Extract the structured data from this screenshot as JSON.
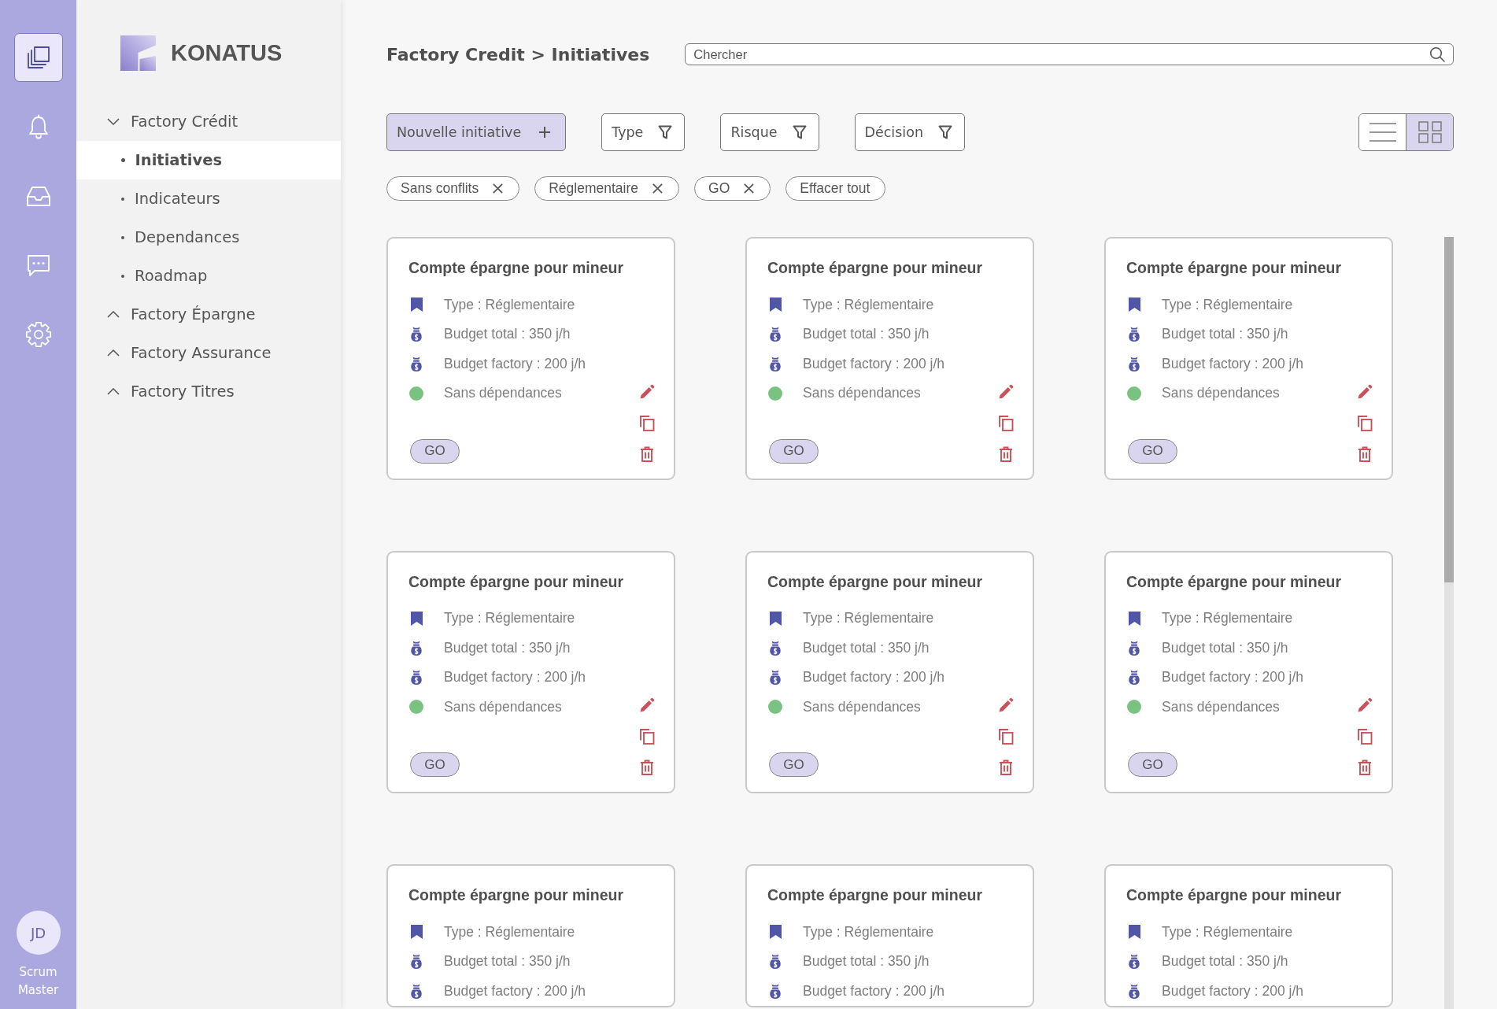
{
  "rail": {
    "items": [
      {
        "kind": "layers",
        "selected": true
      },
      {
        "kind": "bell",
        "selected": false
      },
      {
        "kind": "inbox",
        "selected": false
      },
      {
        "kind": "chat",
        "selected": false
      },
      {
        "kind": "settings",
        "selected": false
      }
    ],
    "user": {
      "initials": "JD",
      "role": "Scrum Master"
    }
  },
  "sidebar": {
    "brand": "KONATUS",
    "tree": [
      {
        "label": "Factory Crédit",
        "expanded": true,
        "children": [
          {
            "label": "Initiatives",
            "selected": true
          },
          {
            "label": "Indicateurs",
            "selected": false
          },
          {
            "label": "Dependances",
            "selected": false
          },
          {
            "label": "Roadmap",
            "selected": false
          }
        ]
      },
      {
        "label": "Factory Épargne",
        "expanded": false
      },
      {
        "label": "Factory Assurance",
        "expanded": false
      },
      {
        "label": "Factory Titres",
        "expanded": false
      }
    ]
  },
  "header": {
    "breadcrumb": "Factory Credit > Initiatives",
    "search": {
      "placeholder": "Chercher"
    }
  },
  "toolbar": {
    "buttons": [
      {
        "label": "Nouvelle initiative",
        "kind": "add"
      },
      {
        "label": "Type",
        "kind": "filter"
      },
      {
        "label": "Risque",
        "kind": "filter"
      },
      {
        "label": "Décision",
        "kind": "filter"
      }
    ],
    "view_toggle": [
      {
        "kind": "list",
        "selected": false
      },
      {
        "kind": "grid",
        "selected": true
      }
    ]
  },
  "active_filters": [
    {
      "label": "Sans conflits",
      "kind": "filter"
    },
    {
      "label": "Réglementaire",
      "kind": "filter"
    },
    {
      "label": "GO",
      "kind": "filter"
    },
    {
      "label": "Effacer tout",
      "kind": "clear"
    }
  ],
  "cards": [
    {
      "title": "Compte épargne pour mineur",
      "rows": [
        {
          "kind": "type",
          "text": "Type : Réglementaire"
        },
        {
          "kind": "budget",
          "text": "Budget total : 350 j/h"
        },
        {
          "kind": "budget",
          "text": "Budget factory : 200 j/h"
        },
        {
          "kind": "status",
          "text": "Sans dépendances",
          "color": "#79c27f"
        }
      ],
      "decision": "GO",
      "actions": [
        {
          "kind": "edit"
        },
        {
          "kind": "copy"
        },
        {
          "kind": "delete"
        }
      ]
    },
    {
      "title": "Compte épargne pour mineur",
      "rows": [
        {
          "kind": "type",
          "text": "Type : Réglementaire"
        },
        {
          "kind": "budget",
          "text": "Budget total : 350 j/h"
        },
        {
          "kind": "budget",
          "text": "Budget factory : 200 j/h"
        },
        {
          "kind": "status",
          "text": "Sans dépendances",
          "color": "#79c27f"
        }
      ],
      "decision": "GO",
      "actions": [
        {
          "kind": "edit"
        },
        {
          "kind": "copy"
        },
        {
          "kind": "delete"
        }
      ]
    },
    {
      "title": "Compte épargne pour mineur",
      "rows": [
        {
          "kind": "type",
          "text": "Type : Réglementaire"
        },
        {
          "kind": "budget",
          "text": "Budget total : 350 j/h"
        },
        {
          "kind": "budget",
          "text": "Budget factory : 200 j/h"
        },
        {
          "kind": "status",
          "text": "Sans dépendances",
          "color": "#79c27f"
        }
      ],
      "decision": "GO",
      "actions": [
        {
          "kind": "edit"
        },
        {
          "kind": "copy"
        },
        {
          "kind": "delete"
        }
      ]
    },
    {
      "title": "Compte épargne pour mineur",
      "rows": [
        {
          "kind": "type",
          "text": "Type : Réglementaire"
        },
        {
          "kind": "budget",
          "text": "Budget total : 350 j/h"
        },
        {
          "kind": "budget",
          "text": "Budget factory : 200 j/h"
        },
        {
          "kind": "status",
          "text": "Sans dépendances",
          "color": "#79c27f"
        }
      ],
      "decision": "GO",
      "actions": [
        {
          "kind": "edit"
        },
        {
          "kind": "copy"
        },
        {
          "kind": "delete"
        }
      ]
    },
    {
      "title": "Compte épargne pour mineur",
      "rows": [
        {
          "kind": "type",
          "text": "Type : Réglementaire"
        },
        {
          "kind": "budget",
          "text": "Budget total : 350 j/h"
        },
        {
          "kind": "budget",
          "text": "Budget factory : 200 j/h"
        },
        {
          "kind": "status",
          "text": "Sans dépendances",
          "color": "#79c27f"
        }
      ],
      "decision": "GO",
      "actions": [
        {
          "kind": "edit"
        },
        {
          "kind": "copy"
        },
        {
          "kind": "delete"
        }
      ]
    },
    {
      "title": "Compte épargne pour mineur",
      "rows": [
        {
          "kind": "type",
          "text": "Type : Réglementaire"
        },
        {
          "kind": "budget",
          "text": "Budget total : 350 j/h"
        },
        {
          "kind": "budget",
          "text": "Budget factory : 200 j/h"
        },
        {
          "kind": "status",
          "text": "Sans dépendances",
          "color": "#79c27f"
        }
      ],
      "decision": "GO",
      "actions": [
        {
          "kind": "edit"
        },
        {
          "kind": "copy"
        },
        {
          "kind": "delete"
        }
      ]
    },
    {
      "title": "Compte épargne pour mineur",
      "rows": [
        {
          "kind": "type",
          "text": "Type : Réglementaire"
        },
        {
          "kind": "budget",
          "text": "Budget total : 350 j/h"
        },
        {
          "kind": "budget",
          "text": "Budget factory : 200 j/h"
        }
      ]
    },
    {
      "title": "Compte épargne pour mineur",
      "rows": [
        {
          "kind": "type",
          "text": "Type : Réglementaire"
        },
        {
          "kind": "budget",
          "text": "Budget total : 350 j/h"
        },
        {
          "kind": "budget",
          "text": "Budget factory : 200 j/h"
        }
      ]
    },
    {
      "title": "Compte épargne pour mineur",
      "rows": [
        {
          "kind": "type",
          "text": "Type : Réglementaire"
        },
        {
          "kind": "budget",
          "text": "Budget total : 350 j/h"
        },
        {
          "kind": "budget",
          "text": "Budget factory : 200 j/h"
        }
      ]
    }
  ]
}
